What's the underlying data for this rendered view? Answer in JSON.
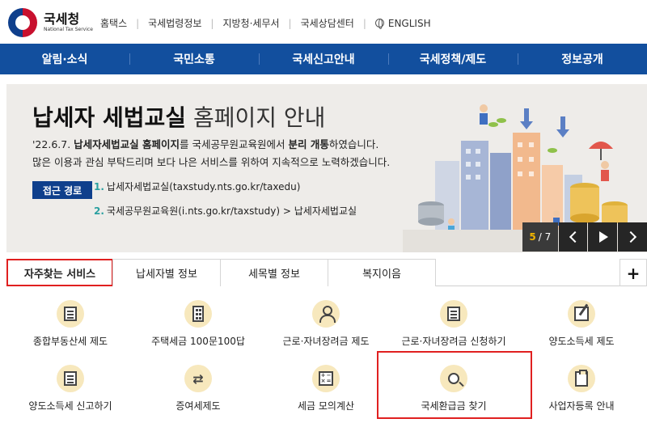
{
  "header": {
    "logo_name": "국세청",
    "logo_sub": "National Tax Service",
    "topnav": [
      "홈택스",
      "국세법령정보",
      "지방청·세무서",
      "국세상담센터"
    ],
    "english": "ENGLISH"
  },
  "gnb": [
    "알림·소식",
    "국민소통",
    "국세신고안내",
    "국세정책/제도",
    "정보공개"
  ],
  "banner": {
    "title_bold": "납세자 세법교실",
    "title_light": "홈페이지 안내",
    "line1_pre": "'22.6.7. ",
    "line1_b1": "납세자세법교실 홈페이지",
    "line1_mid": "를 국세공무원교육원에서 ",
    "line1_b2": "분리 개통",
    "line1_post": "하였습니다.",
    "line2": "많은 이용과 관심 부탁드리며 보다 나은 서비스를 위하여 지속적으로 노력하겠습니다.",
    "badge": "접근 경로",
    "route1_num": "1.",
    "route1": "납세자세법교실(taxstudy.nts.go.kr/taxedu)",
    "route2_num": "2.",
    "route2": "국세공무원교육원(i.nts.go.kr/taxstudy) > 납세자세법교실",
    "pager_current": "5",
    "pager_total": "/ 7"
  },
  "tabs": [
    "자주찾는 서비스",
    "납세자별 정보",
    "세목별 정보",
    "복지이음"
  ],
  "tab_plus": "+",
  "services": [
    {
      "label": "종합부동산세 제도",
      "icon": "ledger-icon"
    },
    {
      "label": "주택세금 100문100답",
      "icon": "building-icon"
    },
    {
      "label": "근로·자녀장려금 제도",
      "icon": "person-icon"
    },
    {
      "label": "근로·자녀장려금 신청하기",
      "icon": "document-icon"
    },
    {
      "label": "양도소득세 제도",
      "icon": "pen-icon"
    },
    {
      "label": "양도소득세 신고하기",
      "icon": "report-icon"
    },
    {
      "label": "증여세제도",
      "icon": "gift-transfer-icon"
    },
    {
      "label": "세금 모의계산",
      "icon": "calculator-icon"
    },
    {
      "label": "국세환급금 찾기",
      "icon": "search-icon"
    },
    {
      "label": "사업자등록 안내",
      "icon": "clipboard-icon"
    }
  ],
  "colors": {
    "nav": "#124f9e",
    "highlight": "#e02020",
    "badge": "#0f3f8c",
    "icon_bg": "#f7e8bd"
  }
}
